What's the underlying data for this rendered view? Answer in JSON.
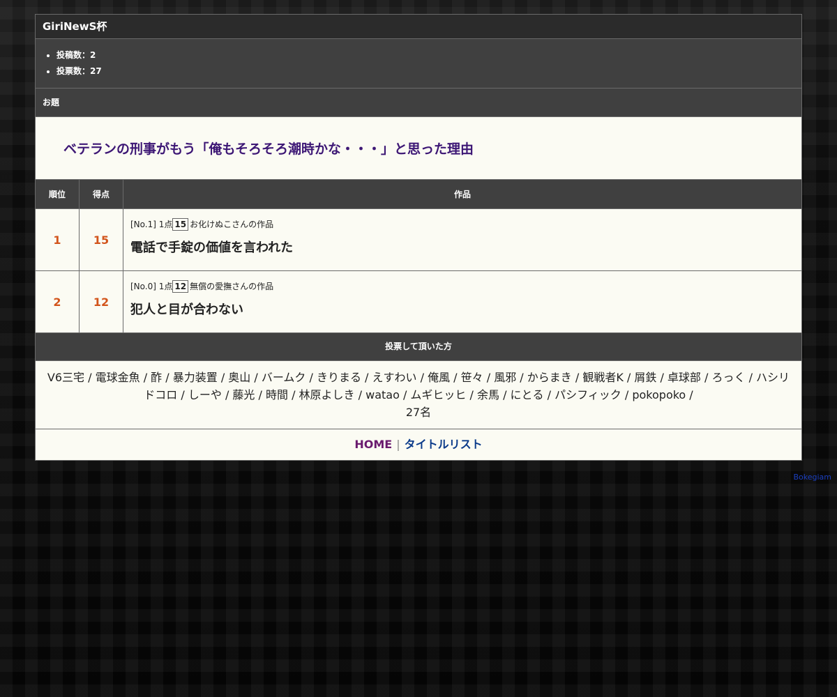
{
  "header": {
    "title": "GiriNewS杯"
  },
  "stats": {
    "posts": "投稿数：2",
    "votes": "投票数：27"
  },
  "odai": {
    "label": "お題",
    "text": "ベテランの刑事がもう「俺もそろそろ潮時かな・・・」と思った理由"
  },
  "table": {
    "headers": {
      "rank": "順位",
      "score": "得点",
      "work": "作品"
    },
    "rows": [
      {
        "rank": "1",
        "score": "15",
        "meta_prefix": "[No.1] 1点",
        "meta_score": "15",
        "meta_author": "お化けぬこさんの作品",
        "title": "電話で手錠の価値を言われた"
      },
      {
        "rank": "2",
        "score": "12",
        "meta_prefix": "[No.0] 1点",
        "meta_score": "12",
        "meta_author": "無償の愛撫さんの作品",
        "title": "犯人と目が合わない"
      }
    ]
  },
  "voters": {
    "label": "投票して頂いた方",
    "list": "V6三宅 / 電球金魚 / 酢 / 暴力装置 / 奥山 / バームク / きりまる / えすわい / 俺風 / 笹々 / 風邪 / からまき / 観戦者K / 屑鉄 / 卓球部 / ろっく / ハシリドコロ / しーや / 藤光 / 時間 / 林原よしき / watao / ムギヒッヒ / 余馬 / にとる / パシフィック / pokopoko /",
    "count": "27名"
  },
  "footer": {
    "home": "HOME",
    "separator": "|",
    "title_list": "タイトルリスト"
  },
  "credit": "Bokegiam"
}
